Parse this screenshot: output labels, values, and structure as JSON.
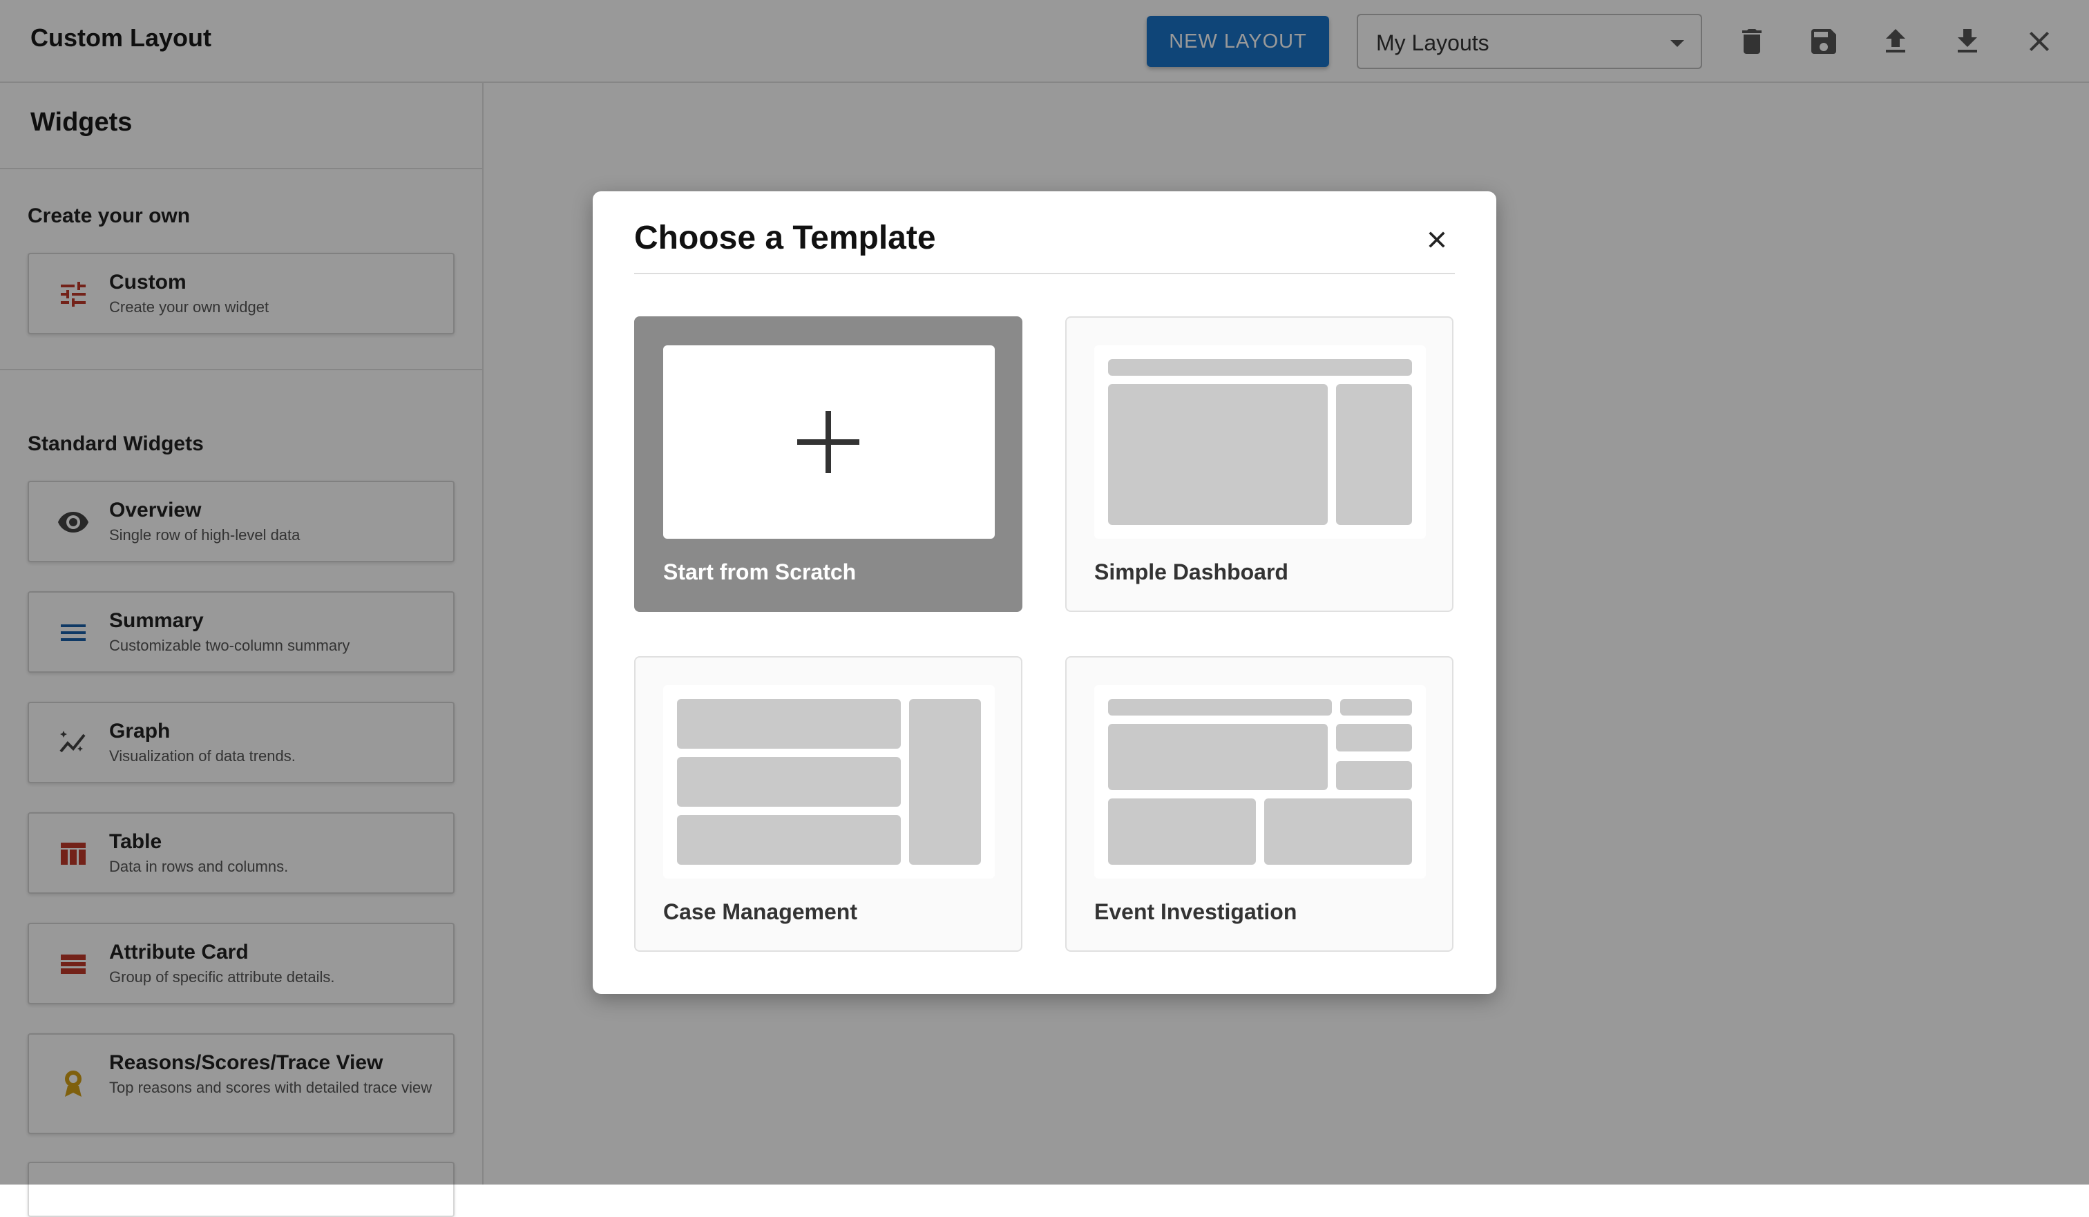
{
  "header": {
    "title": "Custom Layout",
    "new_layout_label": "NEW LAYOUT",
    "layout_select_value": "My Layouts"
  },
  "sidebar": {
    "title": "Widgets",
    "create_section_title": "Create your own",
    "custom_widget": {
      "name": "Custom",
      "desc": "Create your own widget",
      "icon": "tune-icon"
    },
    "standard_section_title": "Standard Widgets",
    "standard_widgets": [
      {
        "name": "Overview",
        "desc": "Single row of high-level data",
        "icon": "eye-icon"
      },
      {
        "name": "Summary",
        "desc": "Customizable two-column summary",
        "icon": "lines-icon"
      },
      {
        "name": "Graph",
        "desc": "Visualization of data trends.",
        "icon": "graph-icon"
      },
      {
        "name": "Table",
        "desc": "Data in rows and columns.",
        "icon": "table-icon"
      },
      {
        "name": "Attribute Card",
        "desc": "Group of specific attribute details.",
        "icon": "list-icon"
      },
      {
        "name": "Reasons/Scores/Trace View",
        "desc": "Top reasons and scores with detailed trace view",
        "icon": "award-icon"
      }
    ]
  },
  "modal": {
    "title": "Choose a Template",
    "templates": [
      {
        "label": "Start from Scratch",
        "selected": true
      },
      {
        "label": "Simple Dashboard",
        "selected": false
      },
      {
        "label": "Case Management",
        "selected": false
      },
      {
        "label": "Event Investigation",
        "selected": false
      }
    ]
  },
  "colors": {
    "primary": "#1a73c8",
    "icon_red": "#c0392b",
    "icon_blue": "#1a5fa8",
    "icon_gold": "#d4a017",
    "selected_card": "#8a8a8a"
  }
}
